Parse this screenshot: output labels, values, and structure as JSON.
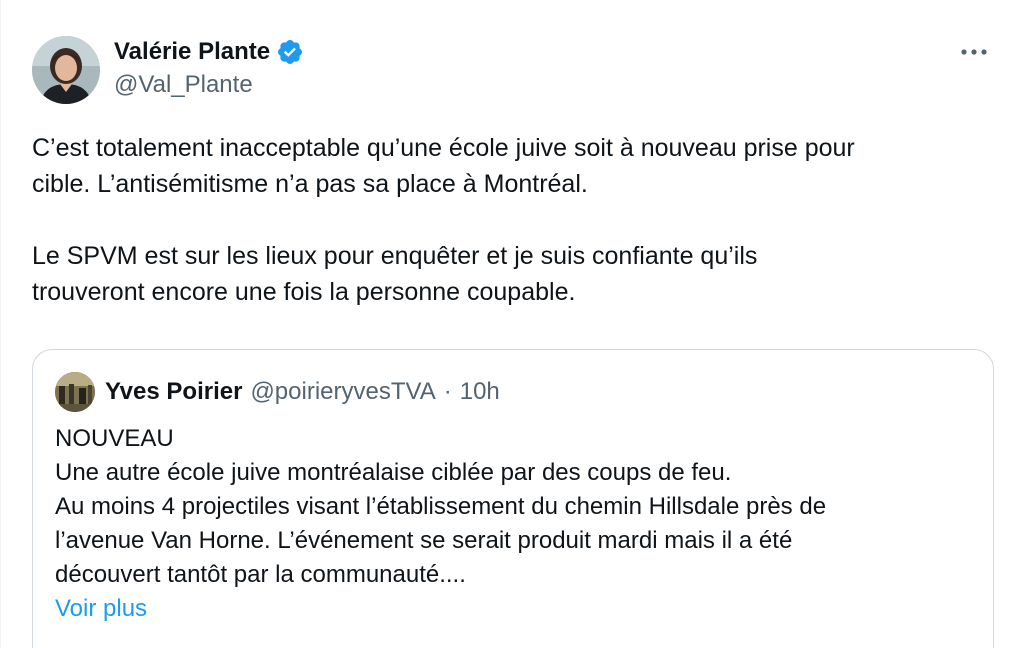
{
  "author": {
    "display_name": "Valérie Plante",
    "handle": "@Val_Plante",
    "avatar_icon": "profile-photo",
    "verified_icon": "verified-badge-icon",
    "verified_color": "#1d9bf0"
  },
  "more_icon": "more-horizontal-icon",
  "tweet": {
    "lines": [
      "C’est totalement inacceptable qu’une école juive soit à nouveau prise pour",
      "cible. L’antisémitisme n’a pas sa place à Montréal.",
      "Le SPVM est sur les lieux pour enquêter et je suis confiante qu’ils",
      "trouveront encore une fois la personne coupable."
    ]
  },
  "quote": {
    "display_name": "Yves Poirier",
    "handle": "@poirieryvesTVA",
    "separator": "·",
    "time": "10h",
    "lines": [
      "NOUVEAU",
      "Une autre école juive montréalaise ciblée par des coups de feu.",
      "Au moins 4 projectiles visant l’établissement du chemin Hillsdale près de",
      "l’avenue Van Horne. L’événement se serait produit mardi mais il a été",
      "découvert tantôt par la communauté...."
    ],
    "show_more": "Voir plus"
  },
  "colors": {
    "text": "#0f1419",
    "secondary": "#536471",
    "link": "#1d9bf0",
    "border": "#cfd9de"
  }
}
